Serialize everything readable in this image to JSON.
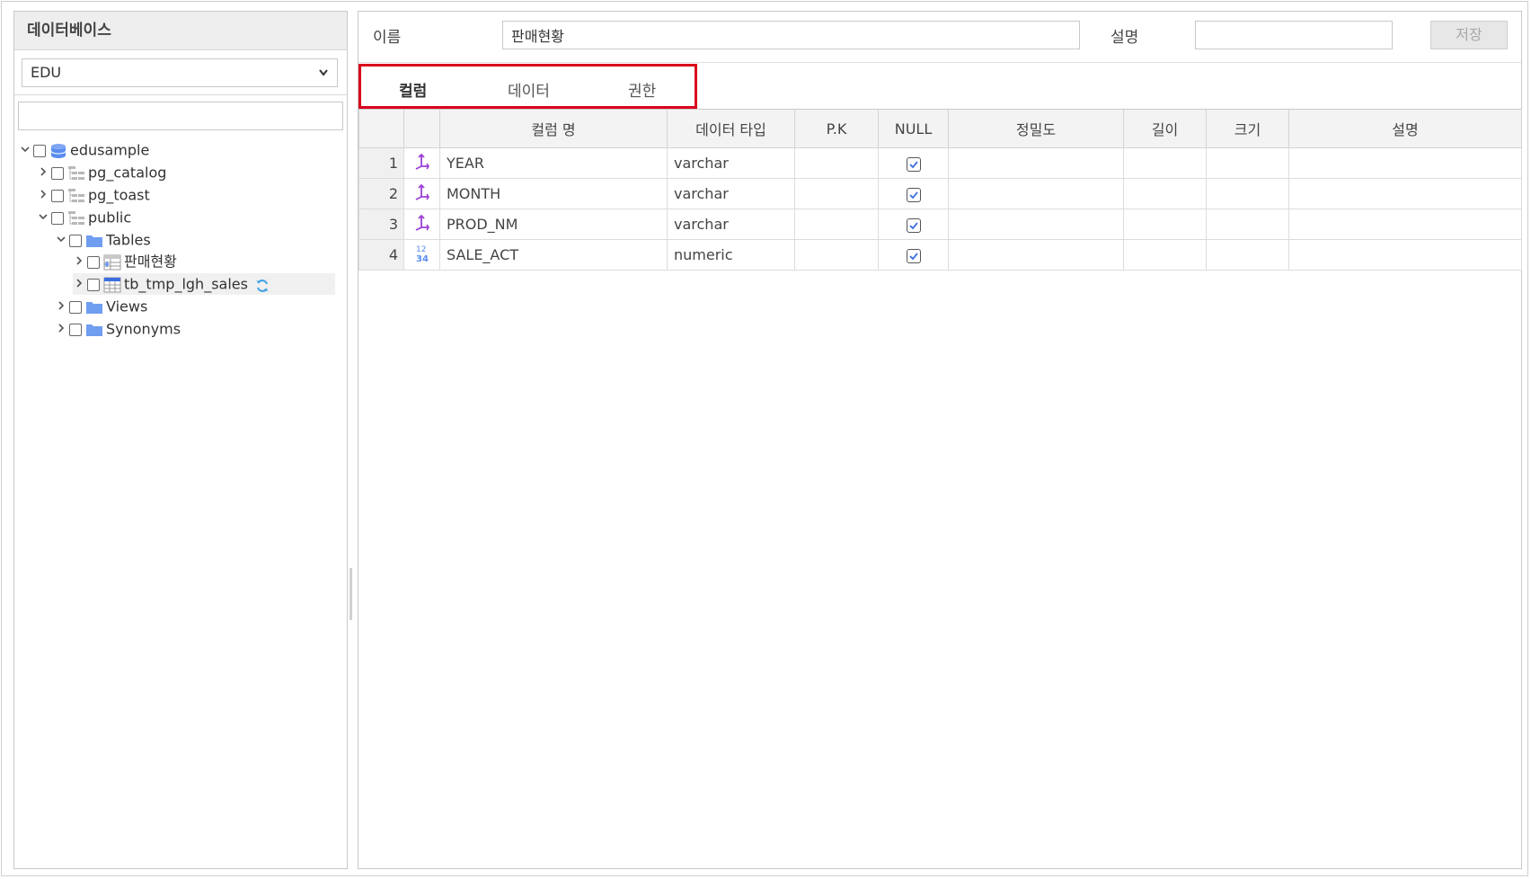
{
  "sidebar": {
    "title": "데이터베이스",
    "db_selected": "EDU",
    "search_value": "",
    "tree": {
      "edusample": "edusample",
      "pg_catalog": "pg_catalog",
      "pg_toast": "pg_toast",
      "public": "public",
      "tables": "Tables",
      "table1": "판매현황",
      "table2": "tb_tmp_lgh_sales",
      "views": "Views",
      "synonyms": "Synonyms"
    }
  },
  "props": {
    "name_label": "이름",
    "name_value": "판매현황",
    "desc_label": "설명",
    "desc_value": "",
    "save_label": "저장"
  },
  "tabs": {
    "columns": "컬럼",
    "data": "데이터",
    "permissions": "권한"
  },
  "grid": {
    "headers": {
      "col_name": "컬럼 명",
      "data_type": "데이터 타입",
      "pk": "P.K",
      "null": "NULL",
      "precision": "정밀도",
      "length": "길이",
      "size": "크기",
      "description": "설명"
    },
    "rows": [
      {
        "no": "1",
        "type_icon": "text-type-icon",
        "name": "YEAR",
        "data_type": "varchar",
        "pk": "",
        "null": true,
        "precision": "",
        "length": "",
        "size": "",
        "description": ""
      },
      {
        "no": "2",
        "type_icon": "text-type-icon",
        "name": "MONTH",
        "data_type": "varchar",
        "pk": "",
        "null": true,
        "precision": "",
        "length": "",
        "size": "",
        "description": ""
      },
      {
        "no": "3",
        "type_icon": "text-type-icon",
        "name": "PROD_NM",
        "data_type": "varchar",
        "pk": "",
        "null": true,
        "precision": "",
        "length": "",
        "size": "",
        "description": ""
      },
      {
        "no": "4",
        "type_icon": "numeric-type-icon",
        "name": "SALE_ACT",
        "data_type": "numeric",
        "pk": "",
        "null": true,
        "precision": "",
        "length": "",
        "size": "",
        "description": ""
      }
    ]
  },
  "colors": {
    "highlight_border": "#d9001b",
    "icon_purple": "#9b3fd6",
    "icon_blue": "#5b8def",
    "refresh_blue": "#3fa1e6"
  }
}
